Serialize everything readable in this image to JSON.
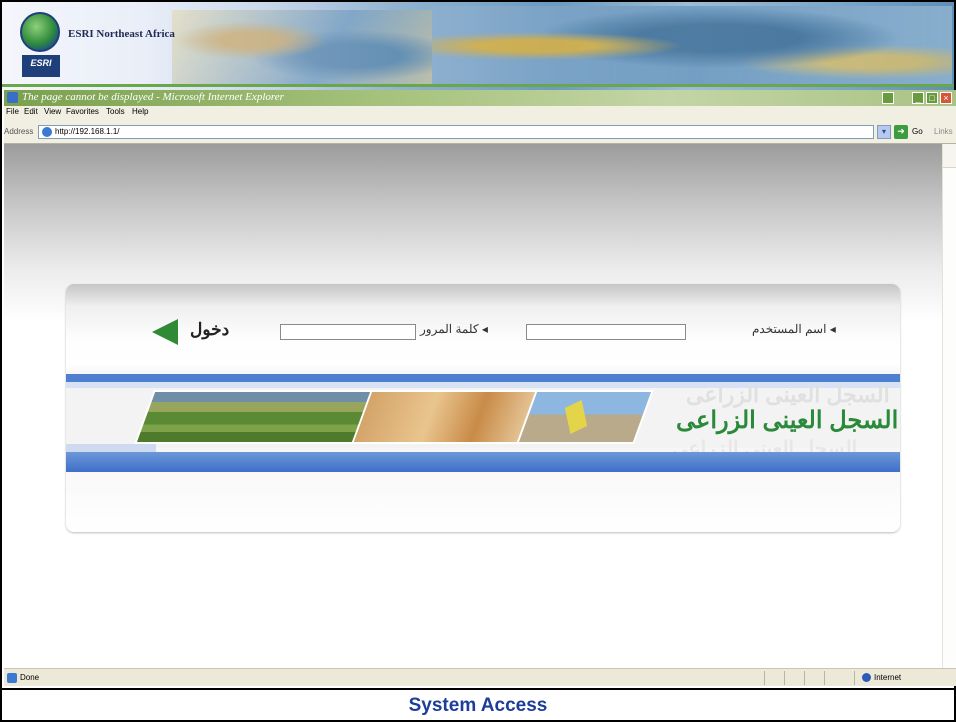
{
  "banner": {
    "logo_text": "ESRI",
    "title": "ESRI Northeast Africa"
  },
  "window": {
    "title": "The page cannot be displayed - Microsoft Internet Explorer",
    "menu": [
      "File",
      "Edit",
      "View",
      "Favorites",
      "Tools",
      "Help"
    ],
    "address_label": "Address",
    "url": "http://192.168.1.1/",
    "go_label": "Go",
    "links_label": "Links"
  },
  "login": {
    "username_label": "◂ اسم المستخدم",
    "password_label": "◂ كلمة المرور",
    "enter_label": "دخول",
    "username_value": "",
    "password_value": ""
  },
  "hero": {
    "title": "السجل العينى الزراعى"
  },
  "status": {
    "text": "Done",
    "zone": "Internet"
  },
  "caption": "System Access",
  "colors": {
    "accent_green": "#2a8a3a",
    "band_blue": "#4f7fd1",
    "caption_blue": "#1d3d9a"
  }
}
